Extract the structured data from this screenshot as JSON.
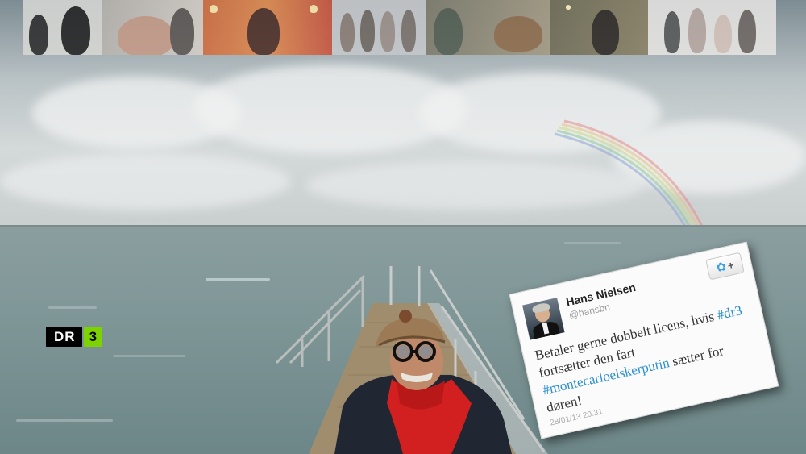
{
  "channel_logo": {
    "left": "DR",
    "right": "3",
    "left_bg": "#000000",
    "right_bg": "#7cd300"
  },
  "thumbnails": [
    {
      "name": "thumb-1"
    },
    {
      "name": "thumb-2"
    },
    {
      "name": "thumb-3"
    },
    {
      "name": "thumb-4"
    },
    {
      "name": "thumb-5"
    },
    {
      "name": "thumb-6"
    },
    {
      "name": "thumb-7"
    }
  ],
  "tweet": {
    "name": "Hans Nielsen",
    "handle": "@hansbn",
    "text_1": "Betaler gerne dobbelt licens, hvis ",
    "tag_1": "#dr3",
    "text_2": " fortsætter den fart ",
    "tag_2": "#montecarloelskerputin",
    "text_3": " sætter for døren!",
    "timestamp": "28/01/13 20.31",
    "follow_icon": "twitter-bird-icon",
    "link_color": "#2b8fd1"
  }
}
